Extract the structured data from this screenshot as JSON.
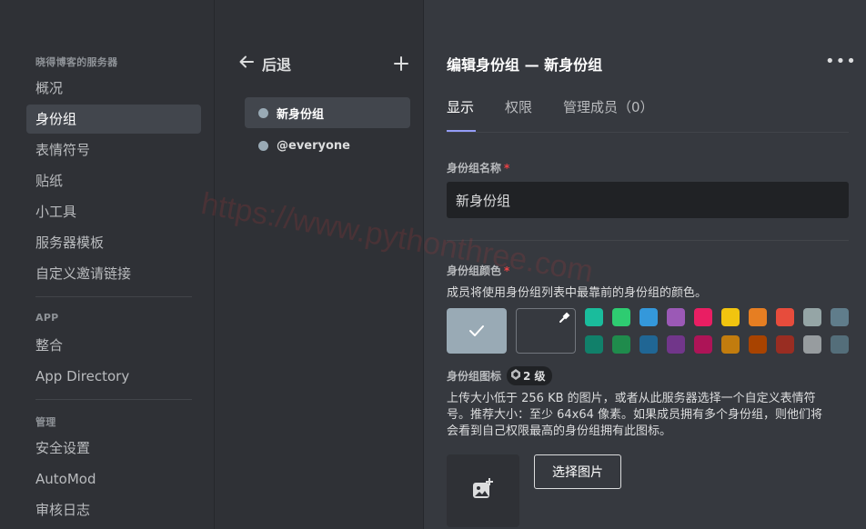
{
  "sidebar": {
    "server_heading": "晓得博客的服务器",
    "server_items": [
      {
        "label": "概况"
      },
      {
        "label": "身份组"
      },
      {
        "label": "表情符号"
      },
      {
        "label": "贴纸"
      },
      {
        "label": "小工具"
      },
      {
        "label": "服务器模板"
      },
      {
        "label": "自定义邀请链接"
      }
    ],
    "app_heading": "APP",
    "app_items": [
      {
        "label": "整合"
      },
      {
        "label": "App Directory"
      }
    ],
    "manage_heading": "管理",
    "manage_items": [
      {
        "label": "安全设置"
      },
      {
        "label": "AutoMod"
      },
      {
        "label": "审核日志"
      }
    ]
  },
  "roles_panel": {
    "back_label": "后退",
    "add_icon": "plus-icon",
    "roles": [
      {
        "name": "新身份组",
        "color": "#99aab5"
      },
      {
        "name": "@everyone",
        "color": "#99aab5"
      }
    ]
  },
  "editor": {
    "title": "编辑身份组 — 新身份组",
    "more_icon": "more-horizontal-icon",
    "tabs": [
      {
        "label": "显示"
      },
      {
        "label": "权限"
      },
      {
        "label": "管理成员（0）"
      }
    ],
    "name_field": {
      "label": "身份组名称",
      "required_mark": "*",
      "value": "新身份组"
    },
    "color_section": {
      "label": "身份组颜色",
      "required_mark": "*",
      "description": "成员将使用身份组列表中最靠前的身份组的颜色。",
      "default_color": "#99aab5",
      "selected_icon": "checkmark-icon",
      "picker_icon": "eyedropper-icon",
      "palette": [
        "#1abc9c",
        "#2ecc71",
        "#3498db",
        "#9b59b6",
        "#e91e63",
        "#f1c40f",
        "#e67e22",
        "#e74c3c",
        "#95a5a6",
        "#607d8b",
        "#11806a",
        "#1f8b4c",
        "#206694",
        "#71368a",
        "#ad1457",
        "#c27c0e",
        "#a84300",
        "#992d22",
        "#979c9f",
        "#546e7a"
      ]
    },
    "icon_section": {
      "label": "身份组图标",
      "level_badge": "2 级",
      "level_icon": "boost-gem-icon",
      "description_lines": [
        "上传大小低于 256 KB 的图片，或者从此服务器选择一个自定义表情符",
        "号。推荐大小：至少 64x64 像素。如果成员拥有多个身份组，则他们将",
        "会看到自己权限最高的身份组拥有此图标。"
      ],
      "upload_icon": "add-image-icon",
      "choose_button": "选择图片"
    }
  },
  "watermark": "https://www.pythonthree.com"
}
